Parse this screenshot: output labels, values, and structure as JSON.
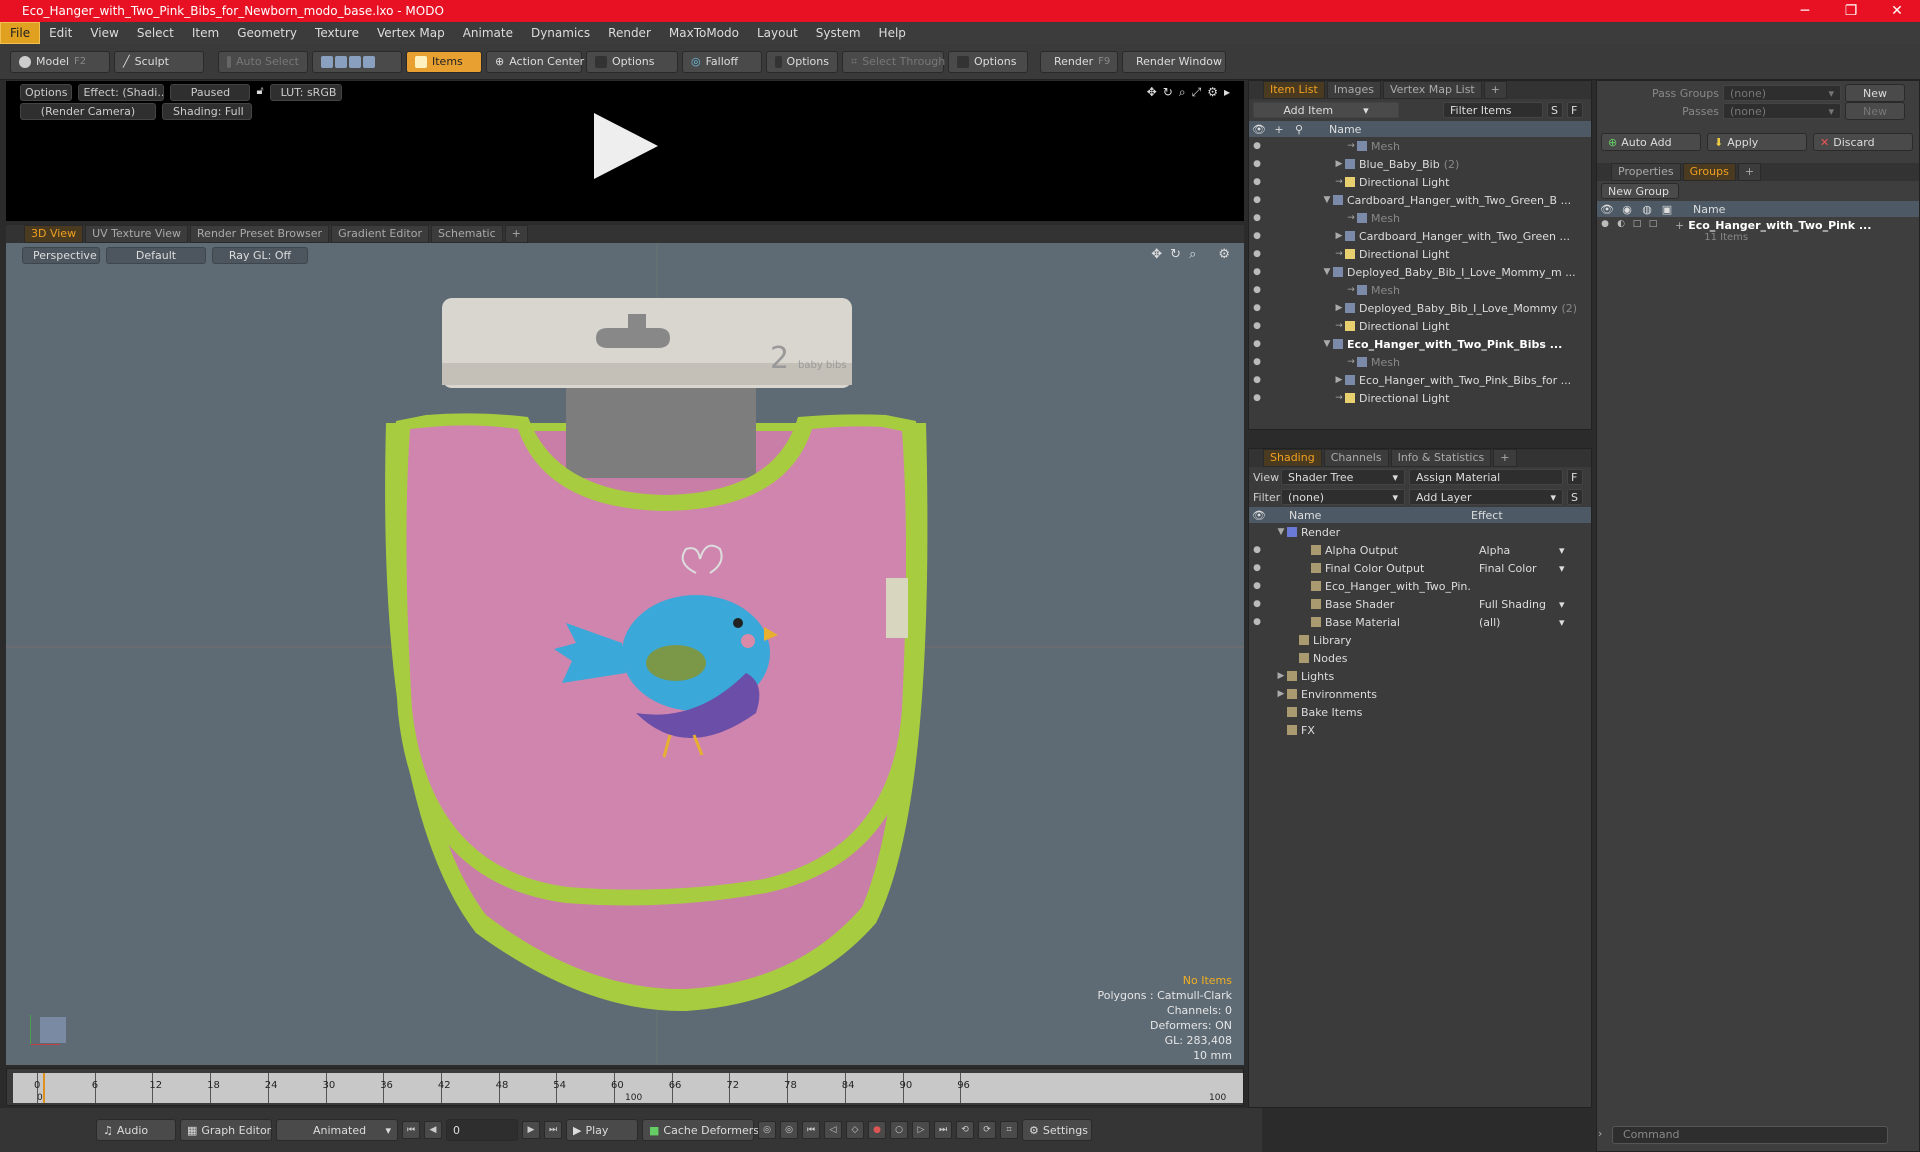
{
  "window": {
    "title": "Eco_Hanger_with_Two_Pink_Bibs_for_Newborn_modo_base.lxo - MODO",
    "minimize": "─",
    "maximize": "❐",
    "close": "✕"
  },
  "menu": [
    "File",
    "Edit",
    "View",
    "Select",
    "Item",
    "Geometry",
    "Texture",
    "Vertex Map",
    "Animate",
    "Dynamics",
    "Render",
    "MaxToModo",
    "Layout",
    "System",
    "Help"
  ],
  "toolbar": {
    "model": "Model",
    "model_key": "F2",
    "sculpt": "Sculpt",
    "auto_select": "Auto Select",
    "items": "Items",
    "action_center": "Action Center",
    "options1": "Options",
    "falloff": "Falloff",
    "options2": "Options",
    "select_through": "Select Through",
    "options3": "Options",
    "render": "Render",
    "render_key": "F9",
    "render_window": "Render Window"
  },
  "preview": {
    "options": "Options",
    "effect": "Effect: (Shadi...",
    "paused": "Paused",
    "lut": "LUT: sRGB",
    "camera": "(Render Camera)",
    "shading": "Shading: Full"
  },
  "viewtabs": [
    "3D View",
    "UV Texture View",
    "Render Preset Browser",
    "Gradient Editor",
    "Schematic",
    "+"
  ],
  "viewport": {
    "perspective": "Perspective",
    "default": "Default",
    "raygl": "Ray GL: Off",
    "label_2": "2",
    "label_baby": "baby bibs"
  },
  "hud": {
    "items": "No Items",
    "polygons": "Polygons : Catmull-Clark",
    "channels": "Channels: 0",
    "deformers": "Deformers: ON",
    "gl": "GL: 283,408",
    "scale": "10 mm"
  },
  "timeline": {
    "ticks": [
      "0",
      "6",
      "12",
      "18",
      "24",
      "30",
      "36",
      "42",
      "48",
      "54",
      "60",
      "66",
      "72",
      "78",
      "84",
      "90",
      "96"
    ],
    "sub_left": "0",
    "sub_mid": "100",
    "sub_right": "100"
  },
  "bottom": {
    "audio": "Audio",
    "graph_editor": "Graph Editor",
    "animated": "Animated",
    "frame": "0",
    "play": "Play",
    "cache": "Cache Deformers",
    "settings": "Settings"
  },
  "itemlist": {
    "tabs": [
      "Item List",
      "Images",
      "Vertex Map List",
      "+"
    ],
    "add_item": "Add Item",
    "filter": "Filter Items",
    "s": "S",
    "f": "F",
    "col_name": "Name",
    "rows": [
      {
        "label": "Mesh",
        "indent": 5,
        "kind": "mesh",
        "dim": true
      },
      {
        "label": "Blue_Baby_Bib",
        "suffix": "(2)",
        "indent": 4,
        "kind": "group"
      },
      {
        "label": "Directional Light",
        "indent": 4,
        "kind": "light"
      },
      {
        "label": "Cardboard_Hanger_with_Two_Green_B ...",
        "indent": 3,
        "kind": "scene"
      },
      {
        "label": "Mesh",
        "indent": 5,
        "kind": "mesh",
        "dim": true
      },
      {
        "label": "Cardboard_Hanger_with_Two_Green ...",
        "indent": 4,
        "kind": "group"
      },
      {
        "label": "Directional Light",
        "indent": 4,
        "kind": "light"
      },
      {
        "label": "Deployed_Baby_Bib_I_Love_Mommy_m ...",
        "indent": 3,
        "kind": "scene"
      },
      {
        "label": "Mesh",
        "indent": 5,
        "kind": "mesh",
        "dim": true
      },
      {
        "label": "Deployed_Baby_Bib_I_Love_Mommy",
        "suffix": "(2)",
        "indent": 4,
        "kind": "group"
      },
      {
        "label": "Directional Light",
        "indent": 4,
        "kind": "light"
      },
      {
        "label": "Eco_Hanger_with_Two_Pink_Bibs ...",
        "indent": 3,
        "kind": "scene",
        "bold": true
      },
      {
        "label": "Mesh",
        "indent": 5,
        "kind": "mesh",
        "dim": true
      },
      {
        "label": "Eco_Hanger_with_Two_Pink_Bibs_for ...",
        "indent": 4,
        "kind": "group"
      },
      {
        "label": "Directional Light",
        "indent": 4,
        "kind": "light"
      }
    ]
  },
  "shading": {
    "tabs": [
      "Shading",
      "Channels",
      "Info & Statistics",
      "+"
    ],
    "view_label": "View",
    "view": "Shader Tree",
    "assign": "Assign Material",
    "filter_label": "Filter",
    "filter": "(none)",
    "add_layer": "Add Layer",
    "col_name": "Name",
    "col_effect": "Effect",
    "rows": [
      {
        "label": "Render",
        "effect": "",
        "indent": 0,
        "eye": false
      },
      {
        "label": "Alpha Output",
        "effect": "Alpha",
        "indent": 2,
        "eye": true
      },
      {
        "label": "Final Color Output",
        "effect": "Final Color",
        "indent": 2,
        "eye": true
      },
      {
        "label": "Eco_Hanger_with_Two_Pin...",
        "effect": "",
        "indent": 2,
        "eye": true
      },
      {
        "label": "Base Shader",
        "effect": "Full Shading",
        "indent": 2,
        "eye": true
      },
      {
        "label": "Base Material",
        "effect": "(all)",
        "indent": 2,
        "eye": true
      },
      {
        "label": "Library",
        "effect": "",
        "indent": 1,
        "eye": false
      },
      {
        "label": "Nodes",
        "effect": "",
        "indent": 1,
        "eye": false
      },
      {
        "label": "Lights",
        "effect": "",
        "indent": 0,
        "eye": false
      },
      {
        "label": "Environments",
        "effect": "",
        "indent": 0,
        "eye": false
      },
      {
        "label": "Bake Items",
        "effect": "",
        "indent": 0,
        "eye": false
      },
      {
        "label": "FX",
        "effect": "",
        "indent": 0,
        "eye": false
      }
    ]
  },
  "groups": {
    "pass_groups": "Pass Groups",
    "pass_value": "(none)",
    "new": "New",
    "passes": "Passes",
    "passes_value": "(none)",
    "new2": "New",
    "auto_add": "Auto Add",
    "apply": "Apply",
    "discard": "Discard",
    "tabs": [
      "Properties",
      "Groups",
      "+"
    ],
    "new_group": "New Group",
    "col_name": "Name",
    "item": "Eco_Hanger_with_Two_Pink ...",
    "item_sub": "11 Items"
  },
  "command": {
    "placeholder": "Command"
  }
}
